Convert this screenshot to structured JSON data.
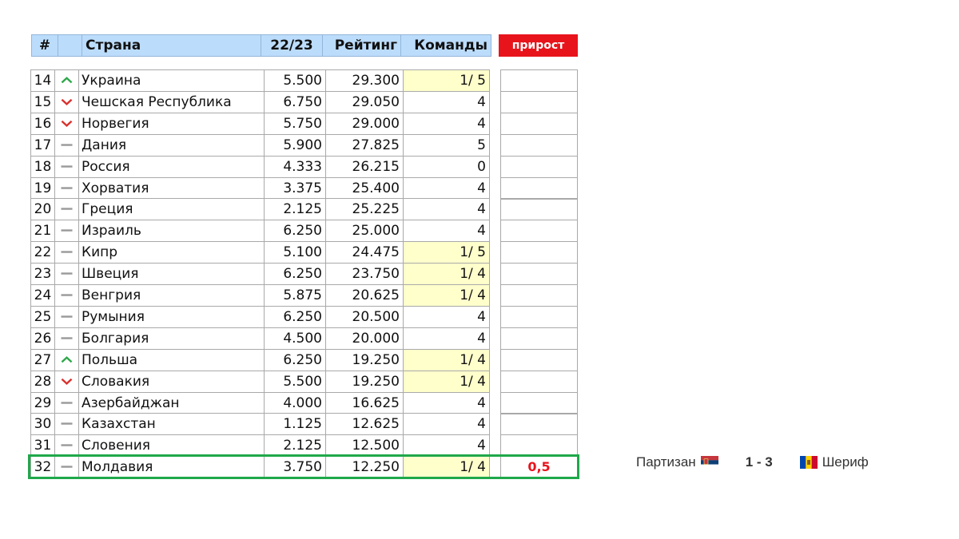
{
  "header": {
    "num": "#",
    "country": "Страна",
    "season": "22/23",
    "rating": "Рейтинг",
    "teams": "Команды",
    "growth": "прирост"
  },
  "rows": [
    {
      "pos": "14",
      "trend": "up",
      "country": "Украина",
      "season": "5.500",
      "rating": "29.300",
      "teams": "1/ 5",
      "hl": true
    },
    {
      "pos": "15",
      "trend": "down",
      "country": "Чешская Республика",
      "season": "6.750",
      "rating": "29.050",
      "teams": "4",
      "hl": false
    },
    {
      "pos": "16",
      "trend": "down",
      "country": "Норвегия",
      "season": "5.750",
      "rating": "29.000",
      "teams": "4",
      "hl": false
    },
    {
      "pos": "17",
      "trend": "flat",
      "country": "Дания",
      "season": "5.900",
      "rating": "27.825",
      "teams": "5",
      "hl": false
    },
    {
      "pos": "18",
      "trend": "flat",
      "country": "Россия",
      "season": "4.333",
      "rating": "26.215",
      "teams": "0",
      "hl": false
    },
    {
      "pos": "19",
      "trend": "flat",
      "country": "Хорватия",
      "season": "3.375",
      "rating": "25.400",
      "teams": "4",
      "hl": false
    },
    {
      "pos": "20",
      "trend": "flat",
      "country": "Греция",
      "season": "2.125",
      "rating": "25.225",
      "teams": "4",
      "hl": false
    },
    {
      "pos": "21",
      "trend": "flat",
      "country": "Израиль",
      "season": "6.250",
      "rating": "25.000",
      "teams": "4",
      "hl": false
    },
    {
      "pos": "22",
      "trend": "flat",
      "country": "Кипр",
      "season": "5.100",
      "rating": "24.475",
      "teams": "1/ 5",
      "hl": true
    },
    {
      "pos": "23",
      "trend": "flat",
      "country": "Швеция",
      "season": "6.250",
      "rating": "23.750",
      "teams": "1/ 4",
      "hl": true
    },
    {
      "pos": "24",
      "trend": "flat",
      "country": "Венгрия",
      "season": "5.875",
      "rating": "20.625",
      "teams": "1/ 4",
      "hl": true
    },
    {
      "pos": "25",
      "trend": "flat",
      "country": "Румыния",
      "season": "6.250",
      "rating": "20.500",
      "teams": "4",
      "hl": false
    },
    {
      "pos": "26",
      "trend": "flat",
      "country": "Болгария",
      "season": "4.500",
      "rating": "20.000",
      "teams": "4",
      "hl": false
    },
    {
      "pos": "27",
      "trend": "up",
      "country": "Польша",
      "season": "6.250",
      "rating": "19.250",
      "teams": "1/ 4",
      "hl": true
    },
    {
      "pos": "28",
      "trend": "down",
      "country": "Словакия",
      "season": "5.500",
      "rating": "19.250",
      "teams": "1/ 4",
      "hl": true
    },
    {
      "pos": "29",
      "trend": "flat",
      "country": "Азербайджан",
      "season": "4.000",
      "rating": "16.625",
      "teams": "4",
      "hl": false
    },
    {
      "pos": "30",
      "trend": "flat",
      "country": "Казахстан",
      "season": "1.125",
      "rating": "12.625",
      "teams": "4",
      "hl": false
    },
    {
      "pos": "31",
      "trend": "flat",
      "country": "Словения",
      "season": "2.125",
      "rating": "12.500",
      "teams": "4",
      "hl": false
    },
    {
      "pos": "32",
      "trend": "flat",
      "country": "Молдавия",
      "season": "3.750",
      "rating": "12.250",
      "teams": "1/ 4",
      "hl": true
    }
  ],
  "selected": {
    "growth_value": "0,5"
  },
  "match": {
    "home": "Партизан",
    "home_flag": "serbia-flag-icon",
    "score": "1 - 3",
    "away": "Шериф",
    "away_flag": "moldova-flag-icon"
  },
  "colors": {
    "header_bg": "#bcdcfb",
    "growth_bg": "#e8141c",
    "highlight_cell": "#ffffcc",
    "selected_border": "#1fa84a",
    "trend_up": "#2fa84a",
    "trend_down": "#d8322f",
    "trend_flat": "#9a9a9a"
  }
}
